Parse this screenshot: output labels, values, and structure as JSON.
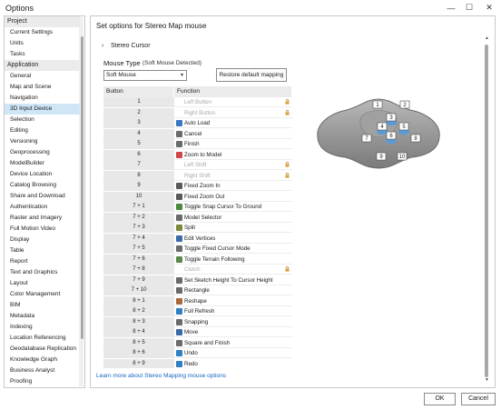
{
  "window": {
    "title": "Options",
    "minimize_glyph": "—",
    "maximize_glyph": "☐",
    "close_glyph": "✕"
  },
  "sidebar": {
    "items": [
      {
        "label": "Project",
        "kind": "header"
      },
      {
        "label": "Current Settings",
        "kind": "item"
      },
      {
        "label": "Units",
        "kind": "item"
      },
      {
        "label": "Tasks",
        "kind": "item"
      },
      {
        "label": "Application",
        "kind": "header"
      },
      {
        "label": "General",
        "kind": "item"
      },
      {
        "label": "Map and Scene",
        "kind": "item"
      },
      {
        "label": "Navigation",
        "kind": "item"
      },
      {
        "label": "3D Input Device",
        "kind": "item",
        "selected": true
      },
      {
        "label": "Selection",
        "kind": "item"
      },
      {
        "label": "Editing",
        "kind": "item"
      },
      {
        "label": "Versioning",
        "kind": "item"
      },
      {
        "label": "Geoprocessing",
        "kind": "item"
      },
      {
        "label": "ModelBuilder",
        "kind": "item"
      },
      {
        "label": "Device Location",
        "kind": "item"
      },
      {
        "label": "Catalog Browsing",
        "kind": "item"
      },
      {
        "label": "Share and Download",
        "kind": "item"
      },
      {
        "label": "Authentication",
        "kind": "item"
      },
      {
        "label": "Raster and Imagery",
        "kind": "item"
      },
      {
        "label": "Full Motion Video",
        "kind": "item"
      },
      {
        "label": "Display",
        "kind": "item"
      },
      {
        "label": "Table",
        "kind": "item"
      },
      {
        "label": "Report",
        "kind": "item"
      },
      {
        "label": "Text and Graphics",
        "kind": "item"
      },
      {
        "label": "Layout",
        "kind": "item"
      },
      {
        "label": "Color Management",
        "kind": "item"
      },
      {
        "label": "BIM",
        "kind": "item"
      },
      {
        "label": "Metadata",
        "kind": "item"
      },
      {
        "label": "Indexing",
        "kind": "item"
      },
      {
        "label": "Location Referencing",
        "kind": "item"
      },
      {
        "label": "Geodatabase Replication",
        "kind": "item"
      },
      {
        "label": "Knowledge Graph",
        "kind": "item"
      },
      {
        "label": "Business Analyst",
        "kind": "item"
      },
      {
        "label": "Proofing",
        "kind": "item"
      }
    ]
  },
  "main": {
    "heading": "Set options for Stereo Map mouse",
    "stereo_cursor_label": "Stereo Cursor",
    "expander_glyph": "›",
    "mouse_type_label": "Mouse Type",
    "mouse_type_note": "(Soft Mouse Detected)",
    "mouse_type_value": "Soft Mouse",
    "combo_arrow": "▾",
    "restore_label": "Restore default mapping",
    "columns": {
      "button": "Button",
      "function": "Function"
    },
    "rows": [
      {
        "button": "1",
        "function": "Left Button",
        "disabled": true,
        "locked": true,
        "icon": "none"
      },
      {
        "button": "2",
        "function": "Right Button",
        "disabled": true,
        "locked": true,
        "icon": "none"
      },
      {
        "button": "3",
        "function": "Auto Load",
        "icon": "auto-load-icon",
        "color": "#3a78c4"
      },
      {
        "button": "4",
        "function": "Cancel",
        "icon": "cancel-icon",
        "color": "#6a6a6a"
      },
      {
        "button": "5",
        "function": "Finish",
        "icon": "finish-icon",
        "color": "#6a6a6a"
      },
      {
        "button": "6",
        "function": "Zoom to Model",
        "icon": "zoom-to-model-icon",
        "color": "#d04646"
      },
      {
        "button": "7",
        "function": "Left Shift",
        "disabled": true,
        "locked": true,
        "icon": "none"
      },
      {
        "button": "8",
        "function": "Right Shift",
        "disabled": true,
        "locked": true,
        "icon": "none"
      },
      {
        "button": "9",
        "function": "Fixed Zoom In",
        "icon": "zoom-in-icon",
        "color": "#5a5a5a"
      },
      {
        "button": "10",
        "function": "Fixed Zoom Out",
        "icon": "zoom-out-icon",
        "color": "#5a5a5a"
      },
      {
        "button": "7 + 1",
        "function": "Toggle Snap Cursor To Ground",
        "icon": "snap-cursor-icon",
        "color": "#4a8a3c"
      },
      {
        "button": "7 + 2",
        "function": "Model Selector",
        "icon": "model-selector-icon",
        "color": "#6a6a6a"
      },
      {
        "button": "7 + 3",
        "function": "Split",
        "icon": "split-icon",
        "color": "#7a8a3c"
      },
      {
        "button": "7 + 4",
        "function": "Edit Vertices",
        "icon": "edit-vertices-icon",
        "color": "#3c6aa8"
      },
      {
        "button": "7 + 5",
        "function": "Toggle Fixed Cursor Mode",
        "icon": "fixed-cursor-icon",
        "color": "#6a6a6a"
      },
      {
        "button": "7 + 6",
        "function": "Toggle Terrain Following",
        "icon": "terrain-icon",
        "color": "#5a8a4a"
      },
      {
        "button": "7 + 8",
        "function": "Clutch",
        "disabled": true,
        "locked": true,
        "icon": "none"
      },
      {
        "button": "7 + 9",
        "function": "Set Sketch Height To Cursor Height",
        "icon": "sketch-height-icon",
        "color": "#6a6a6a"
      },
      {
        "button": "7 + 10",
        "function": "Rectangle",
        "icon": "rectangle-icon",
        "color": "#6a6a6a"
      },
      {
        "button": "8 + 1",
        "function": "Reshape",
        "icon": "reshape-icon",
        "color": "#a86a3c"
      },
      {
        "button": "8 + 2",
        "function": "Full Refresh",
        "icon": "refresh-icon",
        "color": "#2f7fc4"
      },
      {
        "button": "8 + 3",
        "function": "Snapping",
        "icon": "snapping-icon",
        "color": "#6a6a6a"
      },
      {
        "button": "8 + 4",
        "function": "Move",
        "icon": "move-icon",
        "color": "#3c6aa8"
      },
      {
        "button": "8 + 5",
        "function": "Square and Finish",
        "icon": "square-finish-icon",
        "color": "#6a6a6a"
      },
      {
        "button": "8 + 6",
        "function": "Undo",
        "icon": "undo-icon",
        "color": "#2f7fc4"
      },
      {
        "button": "8 + 9",
        "function": "Redo",
        "icon": "redo-icon",
        "color": "#2f7fc4"
      }
    ],
    "learn_more": "Learn more about Stereo Mapping mouse options",
    "mouse_buttons": [
      "1",
      "2",
      "3",
      "4",
      "5",
      "6",
      "7",
      "8",
      "9",
      "10"
    ],
    "mouse_colors": {
      "body": "#8f8f8f",
      "accent": "#5b9bd5"
    }
  },
  "footer": {
    "ok_label": "OK",
    "cancel_label": "Cancel"
  }
}
